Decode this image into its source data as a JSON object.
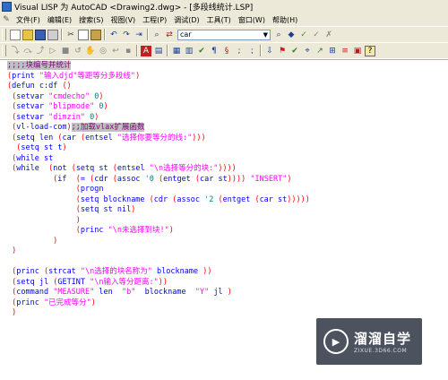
{
  "window": {
    "title": "Visual LISP 为 AutoCAD <Drawing2.dwg> - [多段线统计.LSP]"
  },
  "menu": {
    "items": [
      "文件(F)",
      "编辑(E)",
      "搜索(S)",
      "视图(V)",
      "工程(P)",
      "调试(D)",
      "工具(T)",
      "窗口(W)",
      "帮助(H)"
    ]
  },
  "toolbar": {
    "search_value": "car"
  },
  "code_lines": [
    [
      {
        "t": ";;;;块编号并统计",
        "c": "cm"
      }
    ],
    [
      {
        "t": "(",
        "c": "p"
      },
      {
        "t": "print ",
        "c": "k"
      },
      {
        "t": "\"输入djd\"等距等分多段线\"",
        "c": "s"
      },
      {
        "t": ")",
        "c": "p"
      }
    ],
    [
      {
        "t": "(",
        "c": "p"
      },
      {
        "t": "defun ",
        "c": "k"
      },
      {
        "t": "c:df ",
        "c": "k"
      },
      {
        "t": "()",
        "c": "p"
      }
    ],
    [
      {
        "t": " (",
        "c": "p"
      },
      {
        "t": "setvar ",
        "c": "k"
      },
      {
        "t": "\"cmdecho\" ",
        "c": "s"
      },
      {
        "t": "0",
        "c": "n"
      },
      {
        "t": ")",
        "c": "p"
      }
    ],
    [
      {
        "t": " (",
        "c": "p"
      },
      {
        "t": "setvar ",
        "c": "k"
      },
      {
        "t": "\"blipmode\" ",
        "c": "s"
      },
      {
        "t": "0",
        "c": "n"
      },
      {
        "t": ")",
        "c": "p"
      }
    ],
    [
      {
        "t": " (",
        "c": "p"
      },
      {
        "t": "setvar ",
        "c": "k"
      },
      {
        "t": "\"dimzin\" ",
        "c": "s"
      },
      {
        "t": "0",
        "c": "n"
      },
      {
        "t": ")",
        "c": "p"
      }
    ],
    [
      {
        "t": " (",
        "c": "p"
      },
      {
        "t": "vl-load-com",
        "c": "k"
      },
      {
        "t": ")",
        "c": "p"
      },
      {
        "t": ";;加载vlax扩展函数",
        "c": "cm"
      }
    ],
    [
      {
        "t": " (",
        "c": "p"
      },
      {
        "t": "setq ",
        "c": "k"
      },
      {
        "t": "len ",
        "c": "k"
      },
      {
        "t": "(",
        "c": "p"
      },
      {
        "t": "car ",
        "c": "k"
      },
      {
        "t": "(",
        "c": "p"
      },
      {
        "t": "entsel ",
        "c": "k"
      },
      {
        "t": "\"选择你要等分的线:\"",
        "c": "s"
      },
      {
        "t": ")))",
        "c": "p"
      }
    ],
    [
      {
        "t": "  (",
        "c": "p"
      },
      {
        "t": "setq ",
        "c": "k"
      },
      {
        "t": "st t",
        "c": "k"
      },
      {
        "t": ")",
        "c": "p"
      }
    ],
    [
      {
        "t": " (",
        "c": "p"
      },
      {
        "t": "while ",
        "c": "k"
      },
      {
        "t": "st",
        "c": "k"
      }
    ],
    [
      {
        "t": " (",
        "c": "p"
      },
      {
        "t": "while  ",
        "c": "k"
      },
      {
        "t": "(",
        "c": "p"
      },
      {
        "t": "not ",
        "c": "k"
      },
      {
        "t": "(",
        "c": "p"
      },
      {
        "t": "setq ",
        "c": "k"
      },
      {
        "t": "st ",
        "c": "k"
      },
      {
        "t": "(",
        "c": "p"
      },
      {
        "t": "entsel ",
        "c": "k"
      },
      {
        "t": "\"\\n选择等分的块:\"",
        "c": "s"
      },
      {
        "t": "))))",
        "c": "p"
      }
    ],
    [
      {
        "t": "          (",
        "c": "p"
      },
      {
        "t": "if  ",
        "c": "k"
      },
      {
        "t": "(",
        "c": "p"
      },
      {
        "t": "= ",
        "c": "k"
      },
      {
        "t": "(",
        "c": "p"
      },
      {
        "t": "cdr ",
        "c": "k"
      },
      {
        "t": "(",
        "c": "p"
      },
      {
        "t": "assoc ",
        "c": "k"
      },
      {
        "t": "'0 ",
        "c": "n"
      },
      {
        "t": "(",
        "c": "p"
      },
      {
        "t": "entget ",
        "c": "k"
      },
      {
        "t": "(",
        "c": "p"
      },
      {
        "t": "car ",
        "c": "k"
      },
      {
        "t": "st",
        "c": "k"
      },
      {
        "t": ")))) ",
        "c": "p"
      },
      {
        "t": "\"INSERT\"",
        "c": "s"
      },
      {
        "t": ")",
        "c": "p"
      }
    ],
    [
      {
        "t": "               (",
        "c": "p"
      },
      {
        "t": "progn",
        "c": "k"
      }
    ],
    [
      {
        "t": "               (",
        "c": "p"
      },
      {
        "t": "setq ",
        "c": "k"
      },
      {
        "t": "blockname ",
        "c": "k"
      },
      {
        "t": "(",
        "c": "p"
      },
      {
        "t": "cdr ",
        "c": "k"
      },
      {
        "t": "(",
        "c": "p"
      },
      {
        "t": "assoc ",
        "c": "k"
      },
      {
        "t": "'2 ",
        "c": "n"
      },
      {
        "t": "(",
        "c": "p"
      },
      {
        "t": "entget ",
        "c": "k"
      },
      {
        "t": "(",
        "c": "p"
      },
      {
        "t": "car ",
        "c": "k"
      },
      {
        "t": "st",
        "c": "k"
      },
      {
        "t": ")))))",
        "c": "p"
      }
    ],
    [
      {
        "t": "               (",
        "c": "p"
      },
      {
        "t": "setq ",
        "c": "k"
      },
      {
        "t": "st nil",
        "c": "k"
      },
      {
        "t": ")",
        "c": "p"
      }
    ],
    [
      {
        "t": "               )",
        "c": "p"
      }
    ],
    [
      {
        "t": "               (",
        "c": "p"
      },
      {
        "t": "princ ",
        "c": "k"
      },
      {
        "t": "\"\\n未选择到块!\"",
        "c": "s"
      },
      {
        "t": ")",
        "c": "p"
      }
    ],
    [
      {
        "t": "          )",
        "c": "p"
      }
    ],
    [
      {
        "t": " )",
        "c": "p"
      }
    ],
    [],
    [
      {
        "t": " (",
        "c": "p"
      },
      {
        "t": "princ ",
        "c": "k"
      },
      {
        "t": "(",
        "c": "p"
      },
      {
        "t": "strcat ",
        "c": "k"
      },
      {
        "t": "\"\\n选择的块名称为\" ",
        "c": "s"
      },
      {
        "t": "blockname ",
        "c": "k"
      },
      {
        "t": "))",
        "c": "p"
      }
    ],
    [
      {
        "t": " (",
        "c": "p"
      },
      {
        "t": "setq ",
        "c": "k"
      },
      {
        "t": "jl ",
        "c": "k"
      },
      {
        "t": "(",
        "c": "p"
      },
      {
        "t": "GETINT ",
        "c": "k"
      },
      {
        "t": "\"\\n输入等分距离:\"",
        "c": "s"
      },
      {
        "t": "))",
        "c": "p"
      }
    ],
    [
      {
        "t": " (",
        "c": "p"
      },
      {
        "t": "command ",
        "c": "k"
      },
      {
        "t": "\"MEASURE\" ",
        "c": "s"
      },
      {
        "t": "len  ",
        "c": "k"
      },
      {
        "t": "\"b\"  ",
        "c": "s"
      },
      {
        "t": "blockname  ",
        "c": "k"
      },
      {
        "t": "\"Y\" ",
        "c": "s"
      },
      {
        "t": "jl ",
        "c": "k"
      },
      {
        "t": ")",
        "c": "p"
      }
    ],
    [
      {
        "t": " (",
        "c": "p"
      },
      {
        "t": "princ ",
        "c": "k"
      },
      {
        "t": "\"已完成等分\"",
        "c": "s"
      },
      {
        "t": ")",
        "c": "p"
      }
    ],
    [
      {
        "t": " )",
        "c": "p"
      }
    ]
  ],
  "watermark": {
    "brand": "溜溜自学",
    "url": "ZIXUE.3D66.COM"
  }
}
